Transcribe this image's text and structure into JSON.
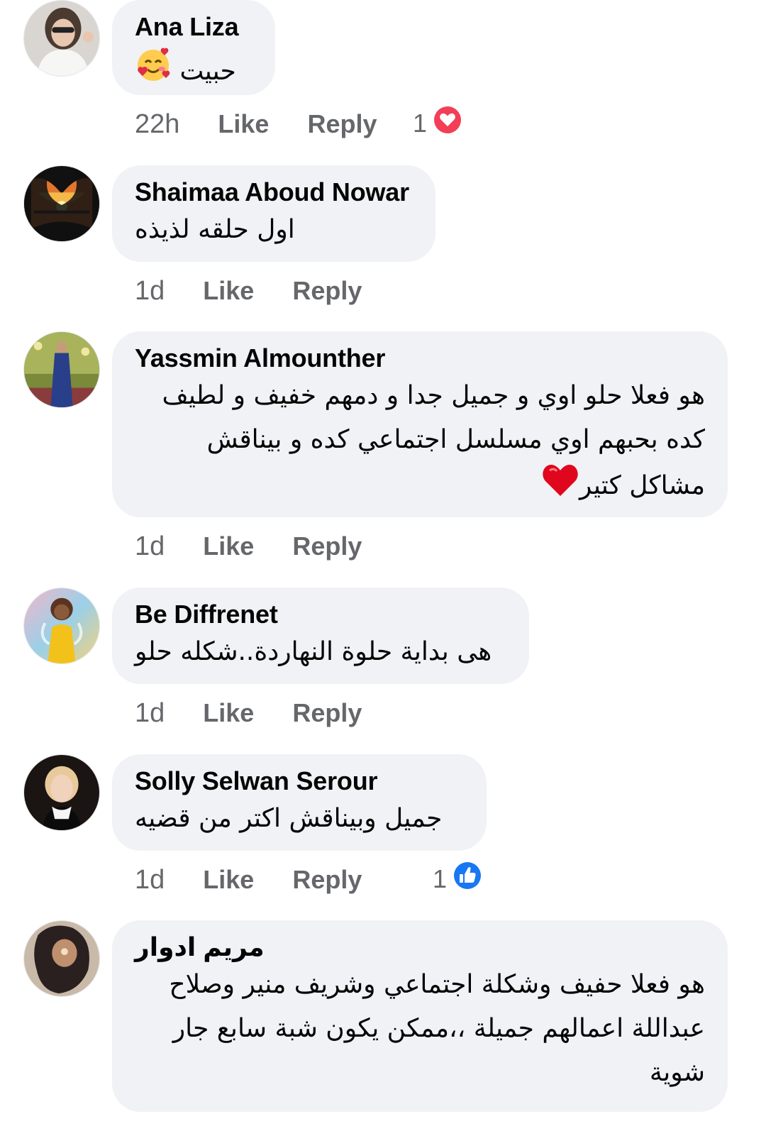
{
  "comments": [
    {
      "author": "Ana Liza",
      "text": "حبيت",
      "emoji": "smiling-face-with-hearts",
      "time": "22h",
      "like_label": "Like",
      "reply_label": "Reply",
      "reaction": {
        "count": "1",
        "type": "love",
        "color": "#f33e58"
      }
    },
    {
      "author": "Shaimaa Aboud Nowar",
      "text": "اول حلقه لذيذه",
      "time": "1d",
      "like_label": "Like",
      "reply_label": "Reply"
    },
    {
      "author": "Yassmin Almounther",
      "lines": [
        "هو فعلا حلو اوي و جميل جدا و دمهم خفيف و لطيف",
        "كده بحبهم اوي مسلسل اجتماعي كده و بيناقش",
        "مشاكل كتير"
      ],
      "emoji": "red-heart",
      "time": "1d",
      "like_label": "Like",
      "reply_label": "Reply"
    },
    {
      "author": "Be Diffrenet",
      "text": "هى بداية حلوة النهاردة..شكله حلو",
      "time": "1d",
      "like_label": "Like",
      "reply_label": "Reply"
    },
    {
      "author": "Solly Selwan Serour",
      "text": "جميل وبيناقش اكتر من قضيه",
      "time": "1d",
      "like_label": "Like",
      "reply_label": "Reply",
      "reaction": {
        "count": "1",
        "type": "like",
        "color": "#1877f2"
      }
    },
    {
      "author": "مريم ادوار",
      "lines": [
        "هو فعلا حفيف وشكلة اجتماعي وشريف منير وصلاح",
        "عبداللة اعمالهم جميلة ،،ممكن يكون شبة سابع جار",
        "شوية"
      ]
    }
  ],
  "colors": {
    "bubble": "#f0f2f5",
    "meta": "#65676b",
    "text": "#050505"
  }
}
